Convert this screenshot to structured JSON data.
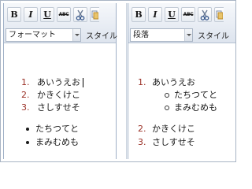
{
  "toolbar": {
    "bold": "B",
    "italic": "I",
    "underline": "U",
    "strike": "ABC"
  },
  "left": {
    "format_select": "フォーマット",
    "style_label": "スタイル",
    "numbered": [
      {
        "num": "1.",
        "text": "あいうえお"
      },
      {
        "num": "2.",
        "text": "かきくけこ"
      },
      {
        "num": "3.",
        "text": "さしすせそ"
      }
    ],
    "bullets": [
      "たちつてと",
      "まみむめも"
    ]
  },
  "right": {
    "format_select": "段落",
    "style_label": "スタイル",
    "item1": {
      "num": "1.",
      "text": "あいうえお"
    },
    "sub_bullets": [
      "たちつてと",
      "まみむめも"
    ],
    "item2": {
      "num": "2.",
      "text": "かきくけこ"
    },
    "item3": {
      "num": "3.",
      "text": "さしすせそ"
    }
  }
}
